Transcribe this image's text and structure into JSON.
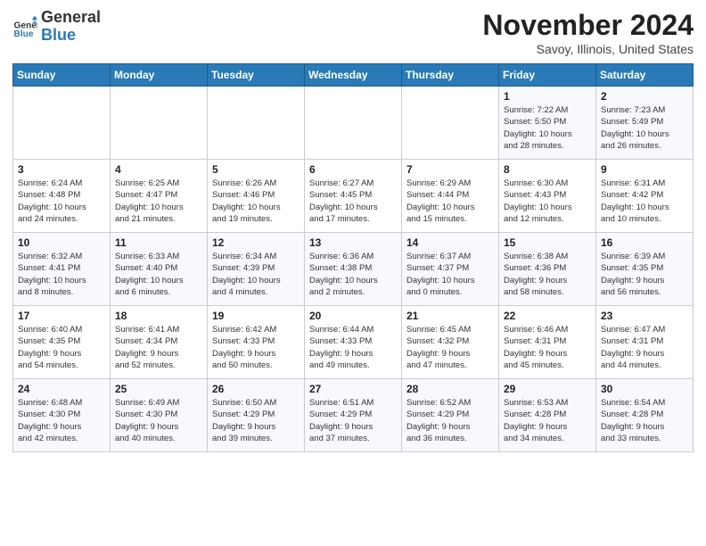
{
  "logo": {
    "general": "General",
    "blue": "Blue"
  },
  "title": "November 2024",
  "location": "Savoy, Illinois, United States",
  "headers": [
    "Sunday",
    "Monday",
    "Tuesday",
    "Wednesday",
    "Thursday",
    "Friday",
    "Saturday"
  ],
  "weeks": [
    [
      {
        "day": "",
        "info": ""
      },
      {
        "day": "",
        "info": ""
      },
      {
        "day": "",
        "info": ""
      },
      {
        "day": "",
        "info": ""
      },
      {
        "day": "",
        "info": ""
      },
      {
        "day": "1",
        "info": "Sunrise: 7:22 AM\nSunset: 5:50 PM\nDaylight: 10 hours\nand 28 minutes."
      },
      {
        "day": "2",
        "info": "Sunrise: 7:23 AM\nSunset: 5:49 PM\nDaylight: 10 hours\nand 26 minutes."
      }
    ],
    [
      {
        "day": "3",
        "info": "Sunrise: 6:24 AM\nSunset: 4:48 PM\nDaylight: 10 hours\nand 24 minutes."
      },
      {
        "day": "4",
        "info": "Sunrise: 6:25 AM\nSunset: 4:47 PM\nDaylight: 10 hours\nand 21 minutes."
      },
      {
        "day": "5",
        "info": "Sunrise: 6:26 AM\nSunset: 4:46 PM\nDaylight: 10 hours\nand 19 minutes."
      },
      {
        "day": "6",
        "info": "Sunrise: 6:27 AM\nSunset: 4:45 PM\nDaylight: 10 hours\nand 17 minutes."
      },
      {
        "day": "7",
        "info": "Sunrise: 6:29 AM\nSunset: 4:44 PM\nDaylight: 10 hours\nand 15 minutes."
      },
      {
        "day": "8",
        "info": "Sunrise: 6:30 AM\nSunset: 4:43 PM\nDaylight: 10 hours\nand 12 minutes."
      },
      {
        "day": "9",
        "info": "Sunrise: 6:31 AM\nSunset: 4:42 PM\nDaylight: 10 hours\nand 10 minutes."
      }
    ],
    [
      {
        "day": "10",
        "info": "Sunrise: 6:32 AM\nSunset: 4:41 PM\nDaylight: 10 hours\nand 8 minutes."
      },
      {
        "day": "11",
        "info": "Sunrise: 6:33 AM\nSunset: 4:40 PM\nDaylight: 10 hours\nand 6 minutes."
      },
      {
        "day": "12",
        "info": "Sunrise: 6:34 AM\nSunset: 4:39 PM\nDaylight: 10 hours\nand 4 minutes."
      },
      {
        "day": "13",
        "info": "Sunrise: 6:36 AM\nSunset: 4:38 PM\nDaylight: 10 hours\nand 2 minutes."
      },
      {
        "day": "14",
        "info": "Sunrise: 6:37 AM\nSunset: 4:37 PM\nDaylight: 10 hours\nand 0 minutes."
      },
      {
        "day": "15",
        "info": "Sunrise: 6:38 AM\nSunset: 4:36 PM\nDaylight: 9 hours\nand 58 minutes."
      },
      {
        "day": "16",
        "info": "Sunrise: 6:39 AM\nSunset: 4:35 PM\nDaylight: 9 hours\nand 56 minutes."
      }
    ],
    [
      {
        "day": "17",
        "info": "Sunrise: 6:40 AM\nSunset: 4:35 PM\nDaylight: 9 hours\nand 54 minutes."
      },
      {
        "day": "18",
        "info": "Sunrise: 6:41 AM\nSunset: 4:34 PM\nDaylight: 9 hours\nand 52 minutes."
      },
      {
        "day": "19",
        "info": "Sunrise: 6:42 AM\nSunset: 4:33 PM\nDaylight: 9 hours\nand 50 minutes."
      },
      {
        "day": "20",
        "info": "Sunrise: 6:44 AM\nSunset: 4:33 PM\nDaylight: 9 hours\nand 49 minutes."
      },
      {
        "day": "21",
        "info": "Sunrise: 6:45 AM\nSunset: 4:32 PM\nDaylight: 9 hours\nand 47 minutes."
      },
      {
        "day": "22",
        "info": "Sunrise: 6:46 AM\nSunset: 4:31 PM\nDaylight: 9 hours\nand 45 minutes."
      },
      {
        "day": "23",
        "info": "Sunrise: 6:47 AM\nSunset: 4:31 PM\nDaylight: 9 hours\nand 44 minutes."
      }
    ],
    [
      {
        "day": "24",
        "info": "Sunrise: 6:48 AM\nSunset: 4:30 PM\nDaylight: 9 hours\nand 42 minutes."
      },
      {
        "day": "25",
        "info": "Sunrise: 6:49 AM\nSunset: 4:30 PM\nDaylight: 9 hours\nand 40 minutes."
      },
      {
        "day": "26",
        "info": "Sunrise: 6:50 AM\nSunset: 4:29 PM\nDaylight: 9 hours\nand 39 minutes."
      },
      {
        "day": "27",
        "info": "Sunrise: 6:51 AM\nSunset: 4:29 PM\nDaylight: 9 hours\nand 37 minutes."
      },
      {
        "day": "28",
        "info": "Sunrise: 6:52 AM\nSunset: 4:29 PM\nDaylight: 9 hours\nand 36 minutes."
      },
      {
        "day": "29",
        "info": "Sunrise: 6:53 AM\nSunset: 4:28 PM\nDaylight: 9 hours\nand 34 minutes."
      },
      {
        "day": "30",
        "info": "Sunrise: 6:54 AM\nSunset: 4:28 PM\nDaylight: 9 hours\nand 33 minutes."
      }
    ]
  ]
}
